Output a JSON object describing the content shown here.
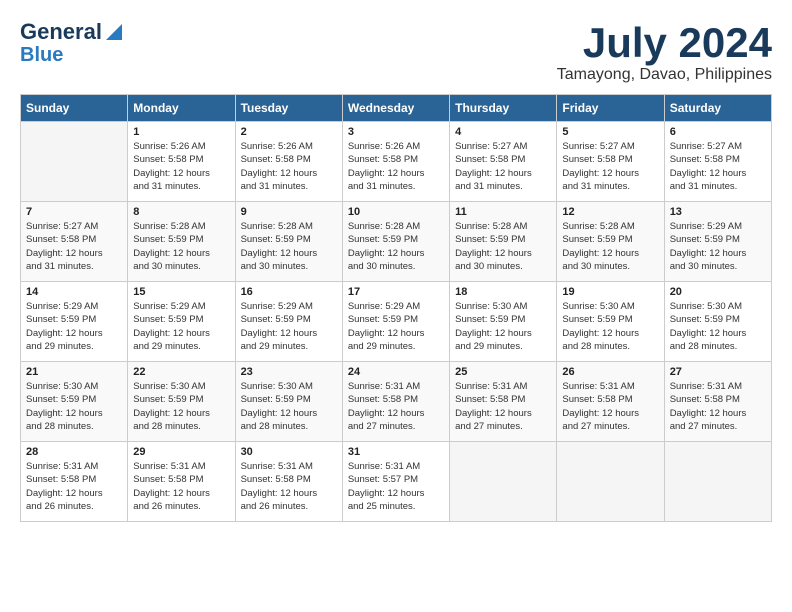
{
  "header": {
    "logo_line1": "General",
    "logo_line2": "Blue",
    "month_year": "July 2024",
    "location": "Tamayong, Davao, Philippines"
  },
  "days_of_week": [
    "Sunday",
    "Monday",
    "Tuesday",
    "Wednesday",
    "Thursday",
    "Friday",
    "Saturday"
  ],
  "weeks": [
    [
      {
        "day": "",
        "info": ""
      },
      {
        "day": "1",
        "info": "Sunrise: 5:26 AM\nSunset: 5:58 PM\nDaylight: 12 hours\nand 31 minutes."
      },
      {
        "day": "2",
        "info": "Sunrise: 5:26 AM\nSunset: 5:58 PM\nDaylight: 12 hours\nand 31 minutes."
      },
      {
        "day": "3",
        "info": "Sunrise: 5:26 AM\nSunset: 5:58 PM\nDaylight: 12 hours\nand 31 minutes."
      },
      {
        "day": "4",
        "info": "Sunrise: 5:27 AM\nSunset: 5:58 PM\nDaylight: 12 hours\nand 31 minutes."
      },
      {
        "day": "5",
        "info": "Sunrise: 5:27 AM\nSunset: 5:58 PM\nDaylight: 12 hours\nand 31 minutes."
      },
      {
        "day": "6",
        "info": "Sunrise: 5:27 AM\nSunset: 5:58 PM\nDaylight: 12 hours\nand 31 minutes."
      }
    ],
    [
      {
        "day": "7",
        "info": "Sunrise: 5:27 AM\nSunset: 5:58 PM\nDaylight: 12 hours\nand 31 minutes."
      },
      {
        "day": "8",
        "info": "Sunrise: 5:28 AM\nSunset: 5:59 PM\nDaylight: 12 hours\nand 30 minutes."
      },
      {
        "day": "9",
        "info": "Sunrise: 5:28 AM\nSunset: 5:59 PM\nDaylight: 12 hours\nand 30 minutes."
      },
      {
        "day": "10",
        "info": "Sunrise: 5:28 AM\nSunset: 5:59 PM\nDaylight: 12 hours\nand 30 minutes."
      },
      {
        "day": "11",
        "info": "Sunrise: 5:28 AM\nSunset: 5:59 PM\nDaylight: 12 hours\nand 30 minutes."
      },
      {
        "day": "12",
        "info": "Sunrise: 5:28 AM\nSunset: 5:59 PM\nDaylight: 12 hours\nand 30 minutes."
      },
      {
        "day": "13",
        "info": "Sunrise: 5:29 AM\nSunset: 5:59 PM\nDaylight: 12 hours\nand 30 minutes."
      }
    ],
    [
      {
        "day": "14",
        "info": "Sunrise: 5:29 AM\nSunset: 5:59 PM\nDaylight: 12 hours\nand 29 minutes."
      },
      {
        "day": "15",
        "info": "Sunrise: 5:29 AM\nSunset: 5:59 PM\nDaylight: 12 hours\nand 29 minutes."
      },
      {
        "day": "16",
        "info": "Sunrise: 5:29 AM\nSunset: 5:59 PM\nDaylight: 12 hours\nand 29 minutes."
      },
      {
        "day": "17",
        "info": "Sunrise: 5:29 AM\nSunset: 5:59 PM\nDaylight: 12 hours\nand 29 minutes."
      },
      {
        "day": "18",
        "info": "Sunrise: 5:30 AM\nSunset: 5:59 PM\nDaylight: 12 hours\nand 29 minutes."
      },
      {
        "day": "19",
        "info": "Sunrise: 5:30 AM\nSunset: 5:59 PM\nDaylight: 12 hours\nand 28 minutes."
      },
      {
        "day": "20",
        "info": "Sunrise: 5:30 AM\nSunset: 5:59 PM\nDaylight: 12 hours\nand 28 minutes."
      }
    ],
    [
      {
        "day": "21",
        "info": "Sunrise: 5:30 AM\nSunset: 5:59 PM\nDaylight: 12 hours\nand 28 minutes."
      },
      {
        "day": "22",
        "info": "Sunrise: 5:30 AM\nSunset: 5:59 PM\nDaylight: 12 hours\nand 28 minutes."
      },
      {
        "day": "23",
        "info": "Sunrise: 5:30 AM\nSunset: 5:59 PM\nDaylight: 12 hours\nand 28 minutes."
      },
      {
        "day": "24",
        "info": "Sunrise: 5:31 AM\nSunset: 5:58 PM\nDaylight: 12 hours\nand 27 minutes."
      },
      {
        "day": "25",
        "info": "Sunrise: 5:31 AM\nSunset: 5:58 PM\nDaylight: 12 hours\nand 27 minutes."
      },
      {
        "day": "26",
        "info": "Sunrise: 5:31 AM\nSunset: 5:58 PM\nDaylight: 12 hours\nand 27 minutes."
      },
      {
        "day": "27",
        "info": "Sunrise: 5:31 AM\nSunset: 5:58 PM\nDaylight: 12 hours\nand 27 minutes."
      }
    ],
    [
      {
        "day": "28",
        "info": "Sunrise: 5:31 AM\nSunset: 5:58 PM\nDaylight: 12 hours\nand 26 minutes."
      },
      {
        "day": "29",
        "info": "Sunrise: 5:31 AM\nSunset: 5:58 PM\nDaylight: 12 hours\nand 26 minutes."
      },
      {
        "day": "30",
        "info": "Sunrise: 5:31 AM\nSunset: 5:58 PM\nDaylight: 12 hours\nand 26 minutes."
      },
      {
        "day": "31",
        "info": "Sunrise: 5:31 AM\nSunset: 5:57 PM\nDaylight: 12 hours\nand 25 minutes."
      },
      {
        "day": "",
        "info": ""
      },
      {
        "day": "",
        "info": ""
      },
      {
        "day": "",
        "info": ""
      }
    ]
  ]
}
